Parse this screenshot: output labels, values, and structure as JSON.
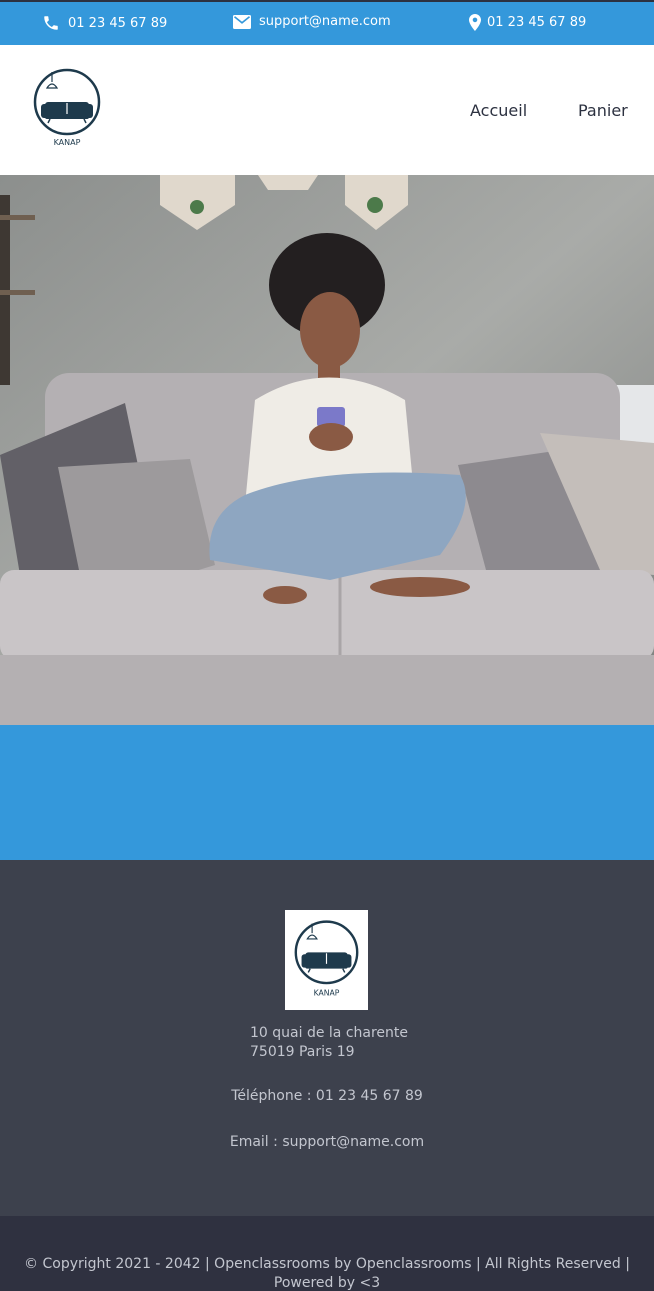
{
  "topbar": {
    "phone": "01 23 45 67 89",
    "email": "support@name.com",
    "location": "01 23 45 67 89",
    "icons": [
      "phone-icon",
      "mail-icon",
      "location-pin-icon"
    ]
  },
  "header": {
    "logo_text": "KANAP",
    "nav": {
      "home": "Accueil",
      "cart": "Panier"
    }
  },
  "footer": {
    "logo_text": "KANAP",
    "address_line1": "10 quai de la charente",
    "address_line2": "75019 Paris 19",
    "phone": "Téléphone : 01 23 45 67 89",
    "email": "Email : support@name.com"
  },
  "copyright": "© Copyright 2021 - 2042 | Openclassrooms by Openclassrooms | All Rights Reserved | Powered by <3",
  "colors": {
    "brand_blue": "#3498db",
    "dark_navy": "#1e3a4c",
    "footer_bg": "#3d414d",
    "copyright_bg": "#2f3140"
  }
}
